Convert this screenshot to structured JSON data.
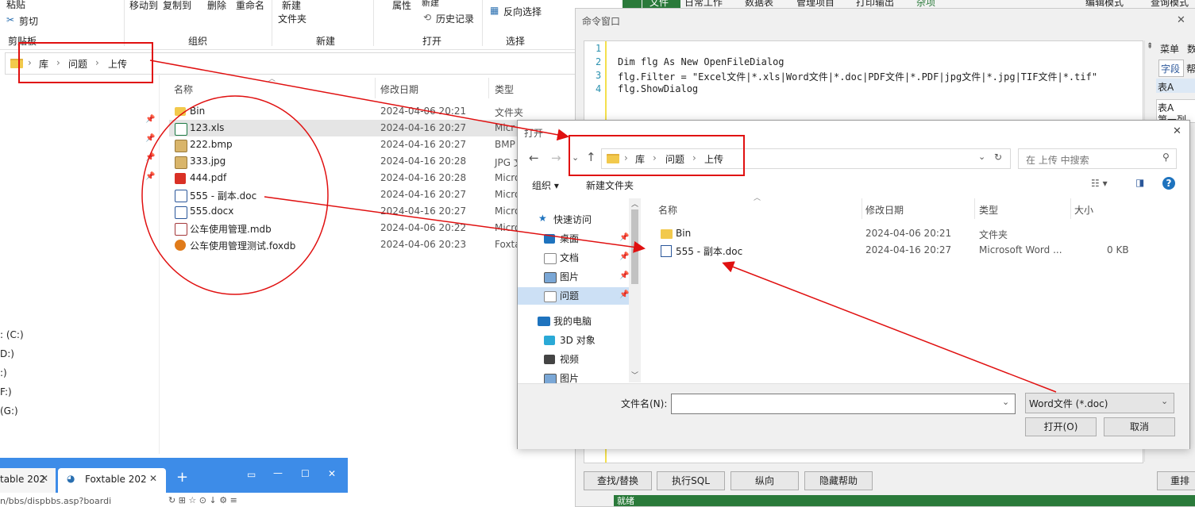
{
  "explorer": {
    "ribbon": {
      "paste": "粘贴",
      "cut": "剪切",
      "clipboard_group": "剪贴板",
      "move_to": "移动到",
      "copy_to": "复制到",
      "delete": "删除",
      "rename": "重命名",
      "organize_group": "组织",
      "new": "新建",
      "new_folder": "文件夹",
      "new_group": "新建",
      "properties": "属性",
      "new_item": "新建",
      "history": "历史记录",
      "open_group": "打开",
      "invert_select": "反向选择",
      "select_group": "选择"
    },
    "breadcrumb": [
      "库",
      "问题",
      "上传"
    ],
    "columns": {
      "name": "名称",
      "date": "修改日期",
      "type": "类型"
    },
    "files": [
      {
        "name": "Bin",
        "date": "2024-04-06 20:21",
        "type": "文件夹",
        "icon": "folder-icon"
      },
      {
        "name": "123.xls",
        "date": "2024-04-16 20:27",
        "type": "Micr",
        "icon": "excel-icon"
      },
      {
        "name": "222.bmp",
        "date": "2024-04-16 20:27",
        "type": "BMP",
        "icon": "image-icon"
      },
      {
        "name": "333.jpg",
        "date": "2024-04-16 20:28",
        "type": "JPG 文",
        "icon": "image-icon"
      },
      {
        "name": "444.pdf",
        "date": "2024-04-16 20:28",
        "type": "Micro",
        "icon": "pdf-icon"
      },
      {
        "name": "555 - 副本.doc",
        "date": "2024-04-16 20:27",
        "type": "Micro",
        "icon": "word-icon"
      },
      {
        "name": "555.docx",
        "date": "2024-04-16 20:27",
        "type": "Micro",
        "icon": "word-icon"
      },
      {
        "name": "公车使用管理.mdb",
        "date": "2024-04-06 20:22",
        "type": "Micro",
        "icon": "access-icon"
      },
      {
        "name": "公车使用管理测试.foxdb",
        "date": "2024-04-06 20:23",
        "type": "Foxta",
        "icon": "foxtable-icon"
      }
    ],
    "drives": [
      ": (C:)",
      "D:)",
      ":)",
      "F:)",
      " (G:)"
    ]
  },
  "app_top": {
    "tabs": [
      "文件",
      "日常工作",
      "数据表",
      "管理项目",
      "打印输出",
      "杂项"
    ],
    "edit_mode": "编辑模式",
    "query_mode": "查询模式"
  },
  "cmd": {
    "title": "命令窗口",
    "lines": [
      {
        "num": "1",
        "text": ""
      },
      {
        "num": "2",
        "text": "Dim flg As New OpenFileDialog"
      },
      {
        "num": "3",
        "text": "flg.Filter = \"Excel文件|*.xls|Word文件|*.doc|PDF文件|*.PDF|jpg文件|*.jpg|TIF文件|*.tif\""
      },
      {
        "num": "4",
        "text": "flg.ShowDialog"
      }
    ],
    "right_panel": {
      "menu": "菜单",
      "data": "数",
      "field": "字段",
      "help": "帮",
      "tableA": "表A",
      "tableA2": "表A",
      "col1": "第一列"
    },
    "buttons": [
      "查找/替换",
      "执行SQL",
      "纵向",
      "隐藏帮助"
    ],
    "right_button": "重排",
    "status": "就绪"
  },
  "dialog": {
    "title": "打开",
    "close": "✕",
    "breadcrumb": [
      "库",
      "问题",
      "上传"
    ],
    "search_placeholder": "在 上传 中搜索",
    "organize": "组织 ▾",
    "new_folder": "新建文件夹",
    "nav": [
      {
        "label": "快速访问",
        "icon": "star-icon"
      },
      {
        "label": "桌面",
        "icon": "desktop-icon"
      },
      {
        "label": "文档",
        "icon": "document-icon"
      },
      {
        "label": "图片",
        "icon": "picture-icon"
      },
      {
        "label": "问题",
        "icon": "library-icon"
      },
      {
        "label": "我的电脑",
        "icon": "computer-icon"
      },
      {
        "label": "3D 对象",
        "icon": "cube-icon"
      },
      {
        "label": "视频",
        "icon": "video-icon"
      },
      {
        "label": "图片",
        "icon": "picture-icon"
      }
    ],
    "columns": {
      "name": "名称",
      "date": "修改日期",
      "type": "类型",
      "size": "大小"
    },
    "files": [
      {
        "name": "Bin",
        "date": "2024-04-06 20:21",
        "type": "文件夹",
        "size": ""
      },
      {
        "name": "555 - 副本.doc",
        "date": "2024-04-16 20:27",
        "type": "Microsoft Word ...",
        "size": "0 KB"
      }
    ],
    "filename_label": "文件名(N):",
    "filename_value": "",
    "filter_value": "Word文件 (*.doc)",
    "open_button": "打开(O)",
    "cancel_button": "取消"
  },
  "browser": {
    "tab1": "table 202",
    "tab2": "Foxtable 202",
    "url": "n/bbs/dispbbs.asp?boardi"
  }
}
